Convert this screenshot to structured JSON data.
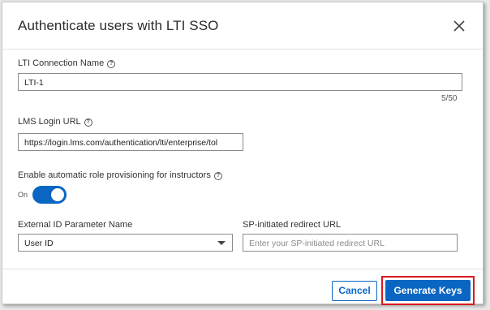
{
  "dialog": {
    "title": "Authenticate users with LTI SSO"
  },
  "fields": {
    "connection_name": {
      "label": "LTI Connection Name",
      "value": "LTI-1",
      "counter": "5/50"
    },
    "login_url": {
      "label": "LMS Login URL",
      "value": "https://login.lms.com/authentication/lti/enterprise/tol"
    },
    "role_provisioning": {
      "label": "Enable automatic role provisioning for instructors",
      "state_label": "On",
      "enabled": true
    },
    "external_id": {
      "label": "External ID Parameter Name",
      "selected": "User ID"
    },
    "sp_redirect": {
      "label": "SP-initiated redirect URL",
      "placeholder": "Enter your SP-initiated redirect URL",
      "value": ""
    }
  },
  "footer": {
    "cancel_label": "Cancel",
    "generate_label": "Generate Keys"
  },
  "icons": {
    "close": "close-icon",
    "help": "help-icon",
    "caret": "chevron-down-icon"
  },
  "colors": {
    "accent": "#0a66c2",
    "highlight": "#d9191f"
  }
}
